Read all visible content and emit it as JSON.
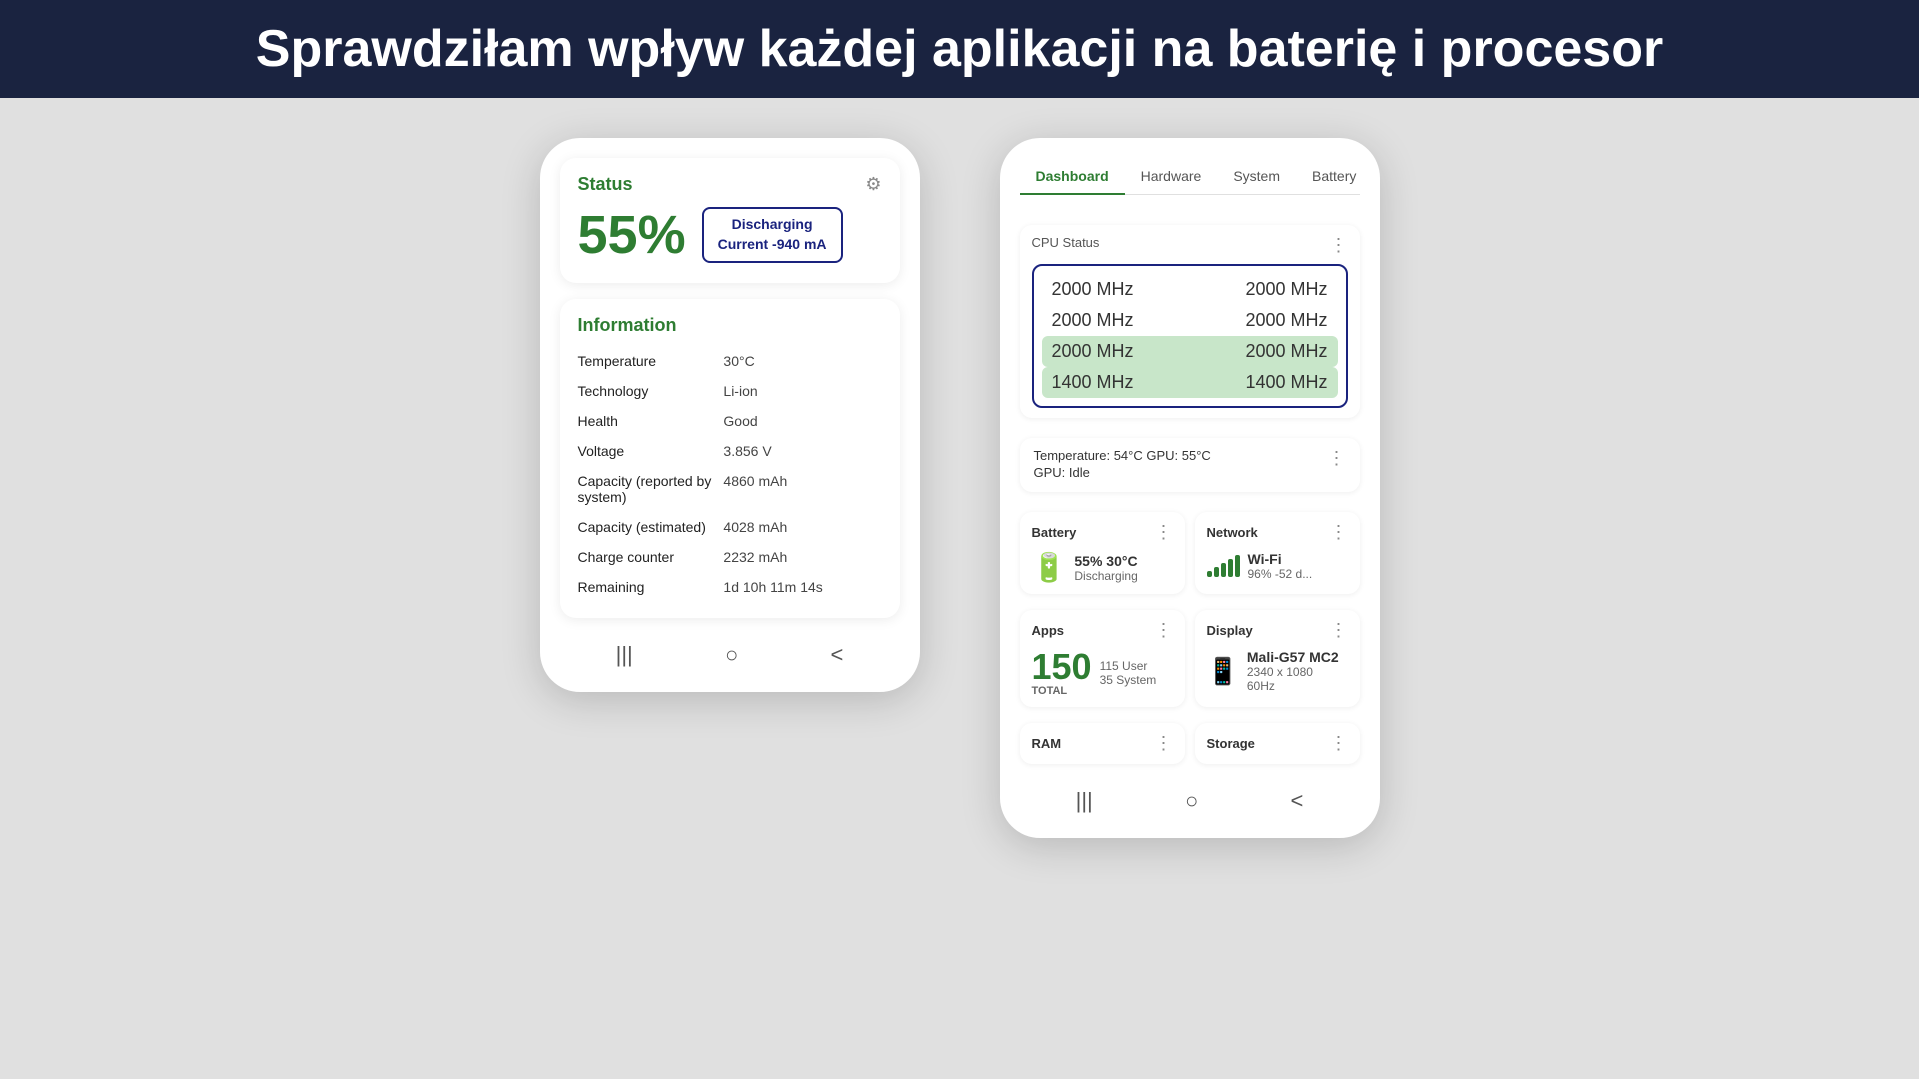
{
  "header": {
    "title": "Sprawdziłam wpływ każdej aplikacji na baterię i procesor"
  },
  "left_phone": {
    "status_card": {
      "title": "Status",
      "percent": "55%",
      "badge_line1": "Discharging",
      "badge_line2": "Current -940 mA"
    },
    "info_card": {
      "title": "Information",
      "rows": [
        {
          "label": "Temperature",
          "value": "30°C"
        },
        {
          "label": "Technology",
          "value": "Li-ion"
        },
        {
          "label": "Health",
          "value": "Good"
        },
        {
          "label": "Voltage",
          "value": "3.856 V"
        },
        {
          "label": "Capacity (reported by system)",
          "value": "4860 mAh"
        },
        {
          "label": "Capacity (estimated)",
          "value": "4028 mAh"
        },
        {
          "label": "Charge counter",
          "value": "2232 mAh"
        },
        {
          "label": "Remaining",
          "value": "1d 10h 11m 14s"
        }
      ]
    }
  },
  "right_phone": {
    "tabs": [
      {
        "label": "Dashboard",
        "active": true
      },
      {
        "label": "Hardware",
        "active": false
      },
      {
        "label": "System",
        "active": false
      },
      {
        "label": "Battery",
        "active": false
      }
    ],
    "cpu_status": {
      "title": "CPU Status",
      "rows": [
        {
          "col1": "2000 MHz",
          "col2": "2000 MHz",
          "highlighted": false
        },
        {
          "col1": "2000 MHz",
          "col2": "2000 MHz",
          "highlighted": false
        },
        {
          "col1": "2000 MHz",
          "col2": "2000 MHz",
          "highlighted": true
        },
        {
          "col1": "1400 MHz",
          "col2": "1400 MHz",
          "highlighted": true
        }
      ]
    },
    "gpu_card": {
      "temp_text": "Temperature: 54°C  GPU: 55°C",
      "gpu_status": "GPU: Idle"
    },
    "battery_widget": {
      "title": "Battery",
      "percent": "55%",
      "temp": "30°C",
      "status": "Discharging"
    },
    "network_widget": {
      "title": "Network",
      "type": "Wi-Fi",
      "strength": "96%",
      "signal": "-52 d..."
    },
    "apps_widget": {
      "title": "Apps",
      "total_number": "150",
      "total_label": "TOTAL",
      "user_apps": "115 User",
      "system_apps": "35 System"
    },
    "display_widget": {
      "title": "Display",
      "gpu": "Mali-G57 MC2",
      "resolution": "2340 x 1080",
      "refresh": "60Hz"
    },
    "ram_section": {
      "title": "RAM"
    },
    "storage_section": {
      "title": "Storage"
    }
  },
  "icons": {
    "gear": "⚙",
    "more_vert": "⋮",
    "back": "<",
    "home": "○",
    "recents": "|||"
  }
}
